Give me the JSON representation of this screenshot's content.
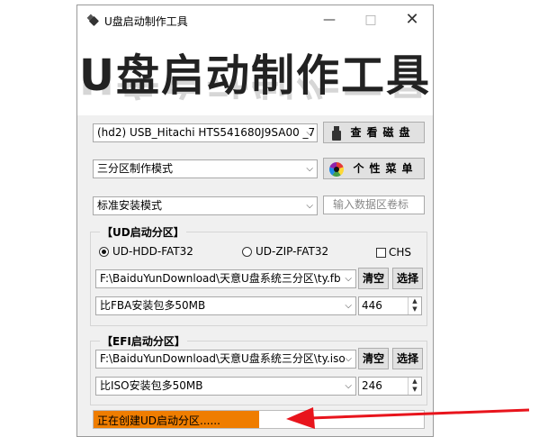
{
  "window": {
    "title": "U盘启动制作工具",
    "banner": "U盘启动制作工具"
  },
  "titlebar_buttons": {
    "minimize": "—",
    "maximize": "□",
    "close": "✕"
  },
  "disk_select": {
    "value": "(hd2) USB_Hitachi HTS541680J9SA00 _7"
  },
  "check_disk_button": {
    "label": "查看磁盘",
    "icon": "usb-drive-icon"
  },
  "mode_select": {
    "value": "三分区制作模式"
  },
  "personal_menu_button": {
    "label": "个性菜单",
    "icon": "color-wheel-icon"
  },
  "install_mode_select": {
    "value": "标准安装模式"
  },
  "volume_label_input": {
    "placeholder": "输入数据区卷标"
  },
  "ud_group": {
    "title": "【UD启动分区】",
    "radio_hdd": "UD-HDD-FAT32",
    "radio_hdd_checked": true,
    "radio_zip": "UD-ZIP-FAT32",
    "radio_zip_checked": false,
    "chs_label": "CHS",
    "chs_checked": false,
    "file_path": "F:\\BaiduYunDownload\\天意U盘系统三分区\\ty.fb",
    "clear_label": "清空",
    "select_label": "选择",
    "size_option": "比FBA安装包多50MB",
    "size_value": "446"
  },
  "efi_group": {
    "title": "【EFI启动分区】",
    "file_path": "F:\\BaiduYunDownload\\天意U盘系统三分区\\ty.iso",
    "clear_label": "清空",
    "select_label": "选择",
    "size_option": "比ISO安装包多50MB",
    "size_value": "246"
  },
  "progress": {
    "text": "正在创建UD启动分区......",
    "fraction": 0.5,
    "color": "#ef7d00"
  },
  "annotation": {
    "arrow_color": "#e8141c"
  }
}
